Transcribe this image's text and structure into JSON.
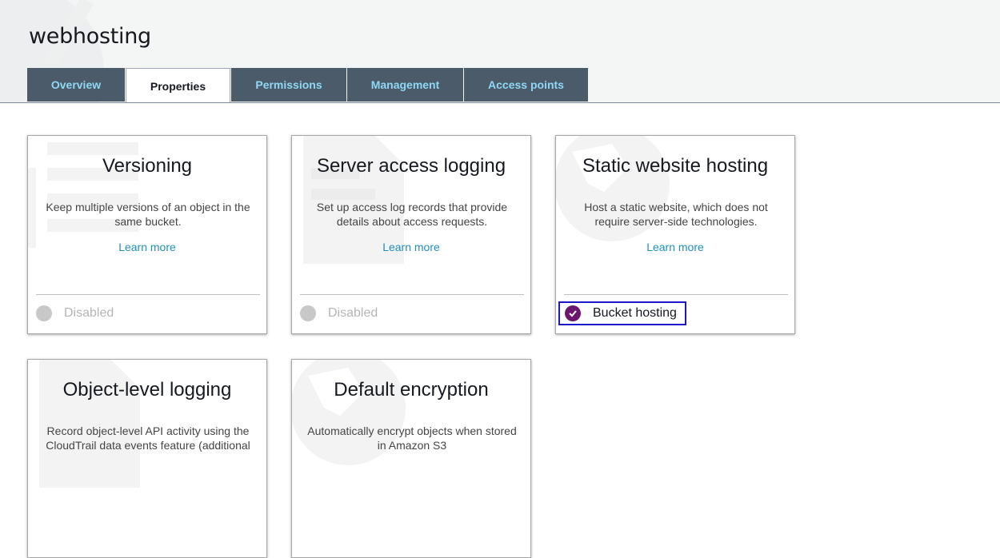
{
  "page": {
    "title": "webhosting"
  },
  "tabs": [
    {
      "label": "Overview",
      "active": false
    },
    {
      "label": "Properties",
      "active": true
    },
    {
      "label": "Permissions",
      "active": false
    },
    {
      "label": "Management",
      "active": false
    },
    {
      "label": "Access points",
      "active": false
    }
  ],
  "cards": [
    {
      "title": "Versioning",
      "description": "Keep multiple versions of an object in the same bucket.",
      "learn_more": "Learn more",
      "status": "Disabled"
    },
    {
      "title": "Server access logging",
      "description": "Set up access log records that provide details about access requests.",
      "learn_more": "Learn more",
      "status": "Disabled"
    },
    {
      "title": "Static website hosting",
      "description": "Host a static website, which does not require server-side technologies.",
      "learn_more": "Learn more",
      "status": "Bucket hosting"
    },
    {
      "title": "Object-level logging",
      "description": "Record object-level API activity using the CloudTrail data events feature (additional"
    },
    {
      "title": "Default encryption",
      "description": "Automatically encrypt objects when stored in Amazon S3"
    }
  ],
  "colors": {
    "tab_bg": "#4b5b69",
    "tab_text": "#8fd8f5",
    "link": "#1f8fbf",
    "enabled_check": "#6b176f",
    "highlight_border": "#1d17c9"
  }
}
